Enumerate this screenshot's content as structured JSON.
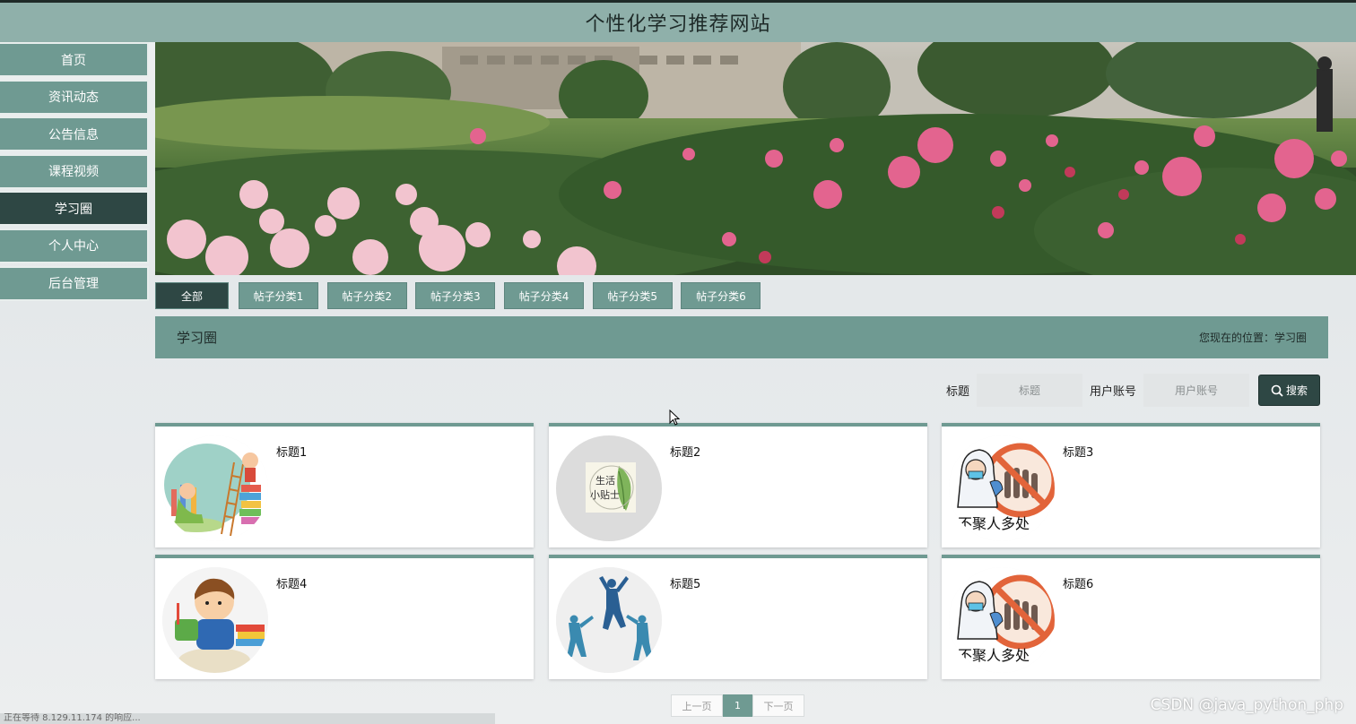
{
  "header": {
    "title": "个性化学习推荐网站"
  },
  "sidebar": {
    "items": [
      {
        "label": "首页"
      },
      {
        "label": "资讯动态"
      },
      {
        "label": "公告信息"
      },
      {
        "label": "课程视频"
      },
      {
        "label": "学习圈",
        "active": true
      },
      {
        "label": "个人中心"
      },
      {
        "label": "后台管理"
      }
    ]
  },
  "categories": [
    "全部",
    "帖子分类1",
    "帖子分类2",
    "帖子分类3",
    "帖子分类4",
    "帖子分类5",
    "帖子分类6"
  ],
  "section": {
    "title": "学习圈",
    "breadcrumb": "您现在的位置：学习圈"
  },
  "search": {
    "title_label": "标题",
    "title_placeholder": "标题",
    "account_label": "用户账号",
    "account_placeholder": "用户账号",
    "button_label": "搜索"
  },
  "posts": [
    {
      "title": "标题1",
      "image": "children-reading-illustration"
    },
    {
      "title": "标题2",
      "image": "life-tips-leaf-icon",
      "image_text": "生活小贴士"
    },
    {
      "title": "标题3",
      "image": "no-gathering-sign",
      "image_text": "不聚人多处"
    },
    {
      "title": "标题4",
      "image": "boy-with-books-illustration"
    },
    {
      "title": "标题5",
      "image": "jumping-people-silhouette"
    },
    {
      "title": "标题6",
      "image": "no-gathering-sign",
      "image_text": "不聚人多处"
    }
  ],
  "pagination": {
    "prev": "上一页",
    "current": "1",
    "next": "下一页"
  },
  "status_bar": {
    "text": "正在等待 8.129.11.174 的响应..."
  },
  "watermark": {
    "text": "CSDN @java_python_php"
  },
  "colors": {
    "primary": "#6f9a92",
    "dark": "#2e4744",
    "header": "#8fb0aa"
  }
}
